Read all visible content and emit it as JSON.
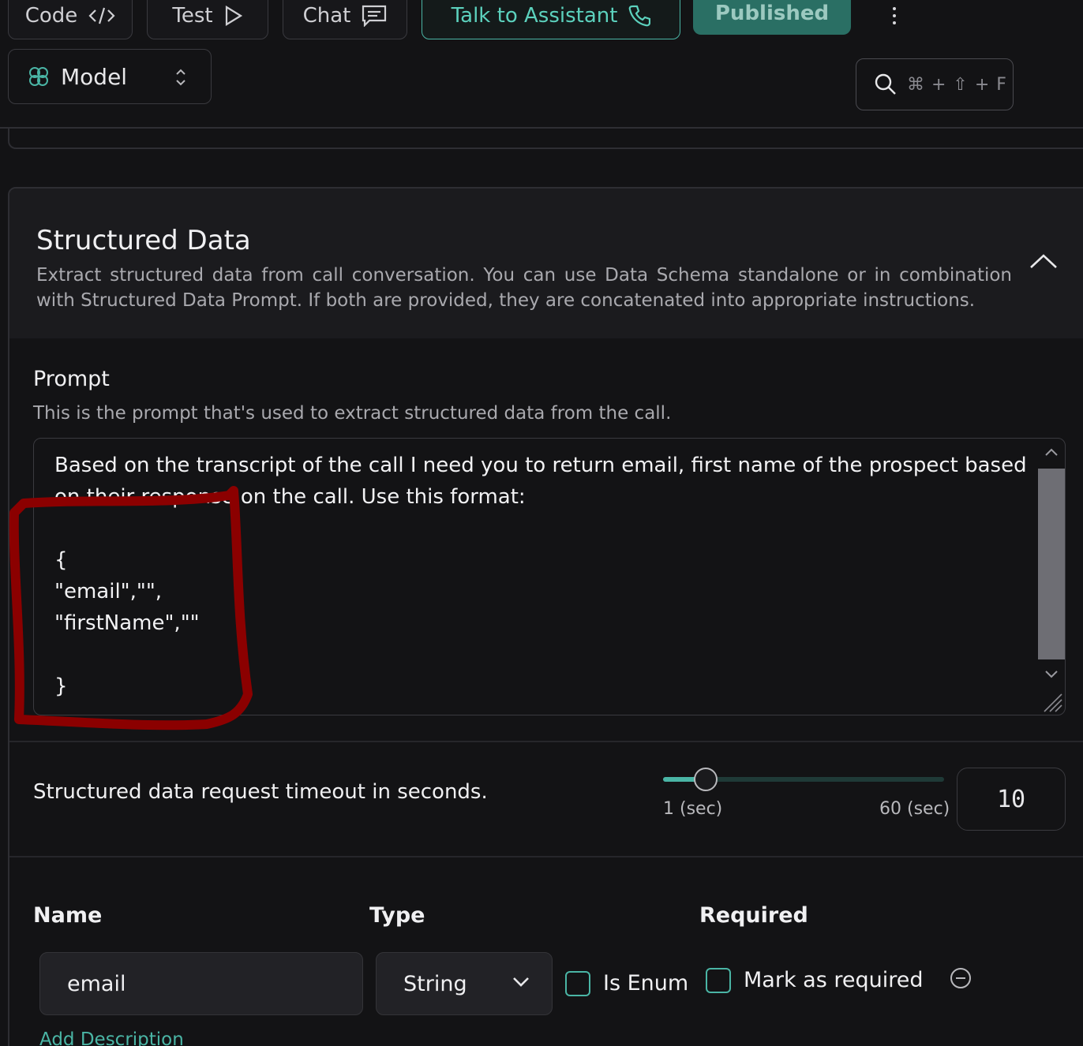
{
  "toolbar": {
    "code_label": "Code",
    "test_label": "Test",
    "chat_label": "Chat",
    "talk_label": "Talk to Assistant",
    "published_label": "Published"
  },
  "model_select": {
    "label": "Model"
  },
  "search": {
    "shortcut": "⌘ + ⇧ + F"
  },
  "structured_data": {
    "title": "Structured Data",
    "description": "Extract structured data from call conversation. You can use Data Schema standalone or in combination with Structured Data Prompt. If both are provided, they are concatenated into appropriate instructions.",
    "prompt_label": "Prompt",
    "prompt_help": "This is the prompt that's used to extract structured data from the call.",
    "prompt_value": "Based on the transcript of the call I need you to return email, first name of the prospect based on their response on the call. Use this format:\n\n{\n\"email\",\"\",\n\"firstName\",\"\"\n\n}",
    "timeout_label": "Structured data request timeout in seconds.",
    "timeout_min_label": "1 (sec)",
    "timeout_max_label": "60 (sec)",
    "timeout_min": 1,
    "timeout_max": 60,
    "timeout_value": "10"
  },
  "schema": {
    "headers": {
      "name": "Name",
      "type": "Type",
      "required": "Required"
    },
    "rows": [
      {
        "name": "email",
        "type": "String",
        "enum_label": "Is Enum",
        "required_label": "Mark as required"
      }
    ],
    "add_description_label": "Add Description"
  },
  "colors": {
    "background": "#131315",
    "accent": "#4ab5a5",
    "published": "#2a6f64",
    "annotation": "#8b0000"
  },
  "icons": [
    "code-icon",
    "play-icon",
    "chat-icon",
    "phone-icon",
    "more-icon",
    "brain-icon",
    "chevron-updown-icon",
    "search-icon",
    "chevron-up-icon",
    "chevron-down-icon",
    "minus-circle-icon",
    "resize-grip-icon"
  ]
}
